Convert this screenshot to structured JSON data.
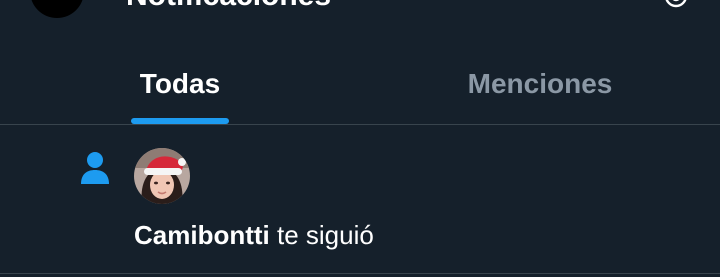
{
  "header": {
    "title": "Notificaciones",
    "settings_icon": "gear-icon"
  },
  "tabs": [
    {
      "label": "Todas",
      "active": true
    },
    {
      "label": "Menciones",
      "active": false
    }
  ],
  "notifications": [
    {
      "type_icon": "person-follow-icon",
      "user": "Camibontti",
      "action": "te siguió"
    }
  ],
  "colors": {
    "background": "#15202b",
    "accent": "#1d9bf0",
    "text": "#ffffff",
    "muted": "#8b98a5",
    "divider": "#38444d"
  }
}
